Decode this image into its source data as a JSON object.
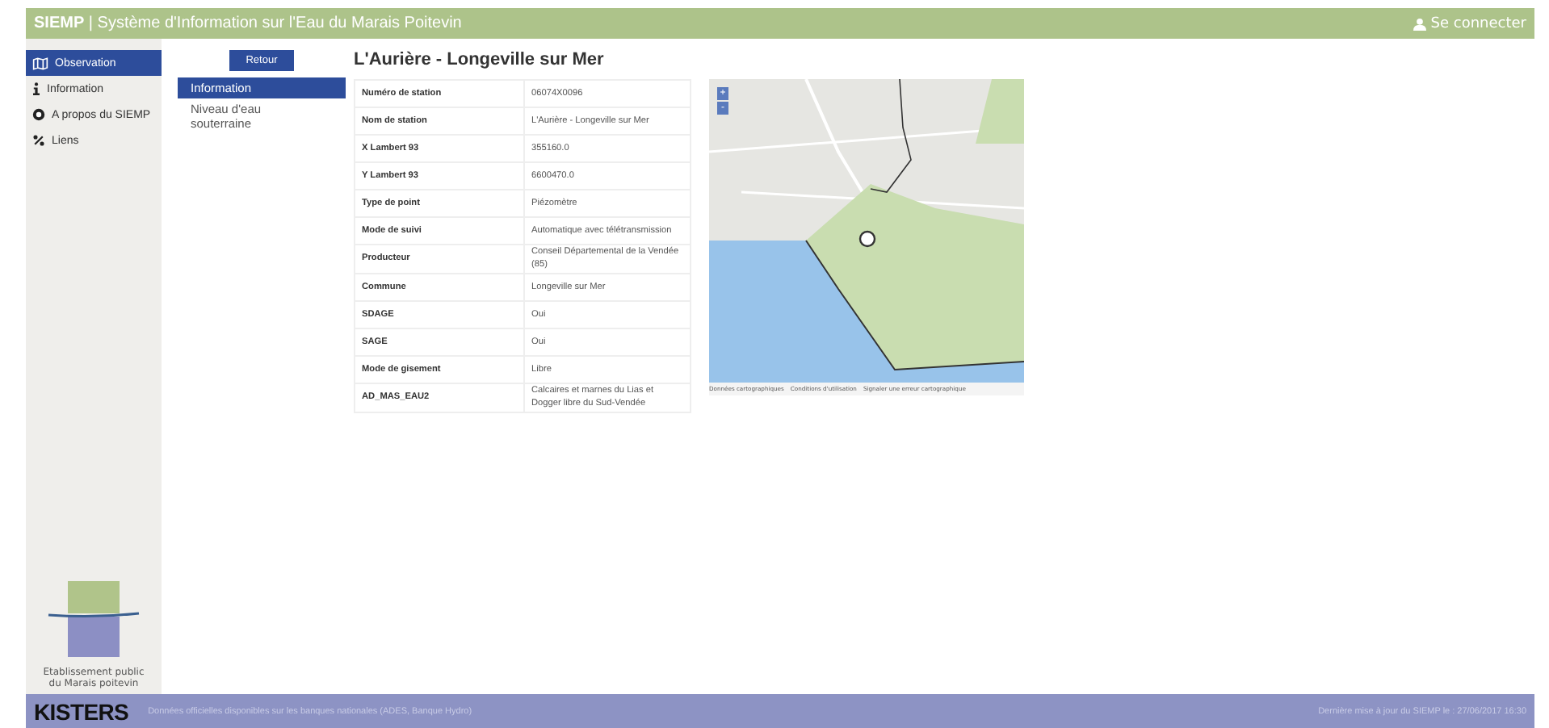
{
  "header": {
    "brand": "SIEMP",
    "separator": "|",
    "subtitle": "Système d'Information sur l'Eau du Marais Poitevin",
    "login": "Se connecter"
  },
  "sidebar": {
    "items": [
      {
        "label": "Observation",
        "selected": true
      },
      {
        "label": "Information",
        "selected": false
      },
      {
        "label": "A propos du SIEMP",
        "selected": false
      },
      {
        "label": "Liens",
        "selected": false
      }
    ],
    "logo_caption": "Etablissement public du Marais poitevin"
  },
  "back_button": "Retour",
  "submenu": [
    {
      "label": "Information",
      "selected": true
    },
    {
      "label": "Niveau d'eau souterraine",
      "selected": false
    }
  ],
  "station_title": "L'Aurière - Longeville sur Mer",
  "table": {
    "rows": [
      {
        "label": "Numéro de station",
        "value": "06074X0096"
      },
      {
        "label": "Nom de station",
        "value": "L'Aurière - Longeville sur Mer"
      },
      {
        "label": "X Lambert 93",
        "value": "355160.0"
      },
      {
        "label": "Y Lambert 93",
        "value": "6600470.0"
      },
      {
        "label": "Type de point",
        "value": "Piézomètre"
      },
      {
        "label": "Mode de suivi",
        "value": "Automatique avec télétransmission"
      },
      {
        "label": "Producteur",
        "value": "Conseil Départemental de la Vendée (85)"
      },
      {
        "label": "Commune",
        "value": "Longeville sur Mer"
      },
      {
        "label": "SDAGE",
        "value": "Oui"
      },
      {
        "label": "SAGE",
        "value": "Oui"
      },
      {
        "label": "Mode de gisement",
        "value": "Libre"
      },
      {
        "label": "AD_MAS_EAU2",
        "value": "Calcaires et marnes du Lias et Dogger libre du Sud-Vendée"
      }
    ]
  },
  "map": {
    "zoom_in": "+",
    "zoom_out": "-",
    "attribution": [
      "Données cartographiques",
      "Conditions d'utilisation",
      "Signaler une erreur cartographique"
    ]
  },
  "footer": {
    "logo": "KISTERS",
    "note": "Données officielles disponibles sur les banques nationales (ADES, Banque Hydro)",
    "updated": "Dernière mise à jour du SIEMP le : 27/06/2017 16:30"
  }
}
